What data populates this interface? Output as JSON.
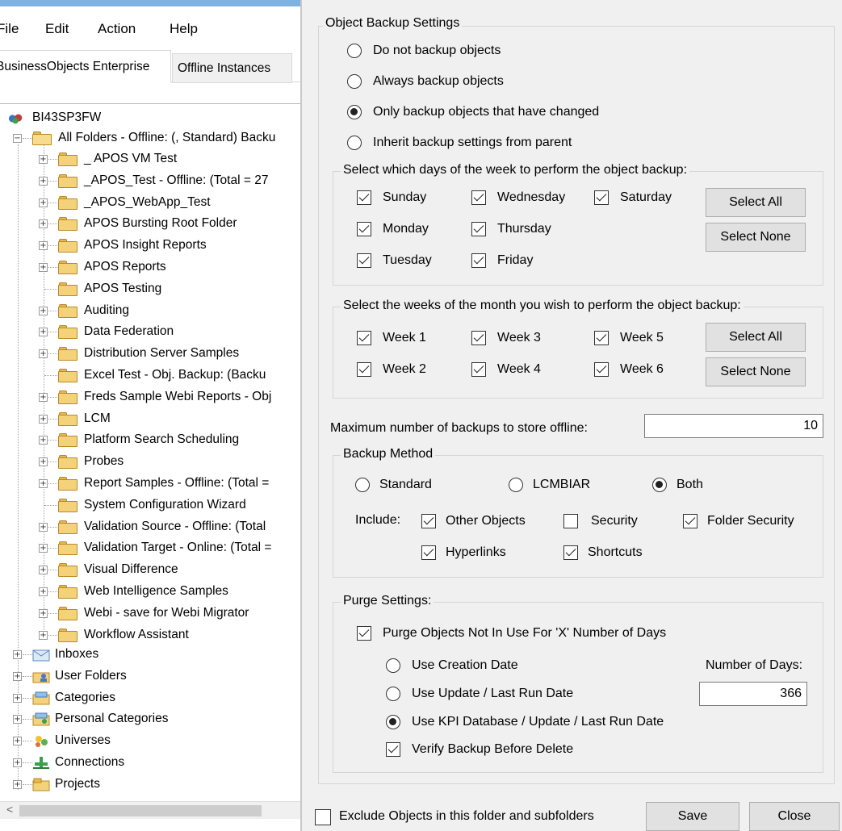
{
  "menu": {
    "file": "File",
    "edit": "Edit",
    "action": "Action",
    "help": "Help"
  },
  "tabs": {
    "enterprise": "BusinessObjects Enterprise",
    "offline": "Offline Instances"
  },
  "tree": {
    "root": "BI43SP3FW",
    "all_folders": "All Folders - Offline: (, Standard) Backu",
    "folders": [
      "_ APOS VM Test",
      "_APOS_Test - Offline: (Total = 27",
      "_APOS_WebApp_Test",
      "APOS Bursting Root Folder",
      "APOS Insight Reports",
      "APOS Reports",
      "APOS Testing",
      "Auditing",
      "Data Federation",
      "Distribution Server Samples",
      "Excel Test -  Obj. Backup: (Backu",
      "Freds Sample Webi Reports -  Obj",
      "LCM",
      "Platform Search Scheduling",
      "Probes",
      "Report Samples - Offline: (Total =",
      "System Configuration Wizard",
      "Validation Source - Offline: (Total",
      "Validation Target - Online: (Total =",
      "Visual Difference",
      "Web Intelligence Samples",
      "Webi - save for Webi Migrator",
      "Workflow Assistant"
    ],
    "top_items": [
      "Inboxes",
      "User Folders",
      "Categories",
      "Personal Categories",
      "Universes",
      "Connections",
      "Projects"
    ]
  },
  "backup_settings": {
    "title": "Object Backup Settings",
    "options": [
      {
        "label": "Do not backup objects",
        "selected": false
      },
      {
        "label": "Always backup objects",
        "selected": false
      },
      {
        "label": "Only backup objects that have changed",
        "selected": true
      },
      {
        "label": "Inherit backup settings from parent",
        "selected": false
      }
    ]
  },
  "days": {
    "title": "Select which days of the week to perform the object backup:",
    "items": [
      {
        "label": "Sunday",
        "checked": true
      },
      {
        "label": "Wednesday",
        "checked": true
      },
      {
        "label": "Saturday",
        "checked": true
      },
      {
        "label": "Monday",
        "checked": true
      },
      {
        "label": "Thursday",
        "checked": true
      },
      {
        "label": "Tuesday",
        "checked": true
      },
      {
        "label": "Friday",
        "checked": true
      }
    ],
    "select_all": "Select All",
    "select_none": "Select None"
  },
  "weeks": {
    "title": "Select the weeks of the month you wish to perform the object backup:",
    "items": [
      {
        "label": "Week 1",
        "checked": true
      },
      {
        "label": "Week 3",
        "checked": true
      },
      {
        "label": "Week 5",
        "checked": true
      },
      {
        "label": "Week 2",
        "checked": true
      },
      {
        "label": "Week 4",
        "checked": true
      },
      {
        "label": "Week 6",
        "checked": true
      }
    ],
    "select_all": "Select All",
    "select_none": "Select None"
  },
  "max_backups": {
    "label": "Maximum number of backups to store offline:",
    "value": "10"
  },
  "method": {
    "title": "Backup Method",
    "options": [
      {
        "label": "Standard",
        "selected": false
      },
      {
        "label": "LCMBIAR",
        "selected": false
      },
      {
        "label": "Both",
        "selected": true
      }
    ],
    "include_label": "Include:",
    "include": [
      {
        "label": "Other Objects",
        "checked": true
      },
      {
        "label": "Security",
        "checked": false
      },
      {
        "label": "Folder Security",
        "checked": true
      },
      {
        "label": "Hyperlinks",
        "checked": true
      },
      {
        "label": "Shortcuts",
        "checked": true
      }
    ]
  },
  "purge": {
    "title": "Purge Settings:",
    "purge_check": {
      "label": "Purge Objects Not In Use For 'X' Number of Days",
      "checked": true
    },
    "date_options": [
      {
        "label": "Use Creation Date",
        "selected": false
      },
      {
        "label": "Use Update / Last Run Date",
        "selected": false
      },
      {
        "label": "Use KPI Database / Update / Last Run Date",
        "selected": true
      }
    ],
    "verify": {
      "label": "Verify Backup Before Delete",
      "checked": true
    },
    "days_label": "Number of Days:",
    "days_value": "366"
  },
  "footer": {
    "exclude": {
      "label": "Exclude Objects in this folder and subfolders",
      "checked": false
    },
    "save": "Save",
    "close": "Close"
  }
}
